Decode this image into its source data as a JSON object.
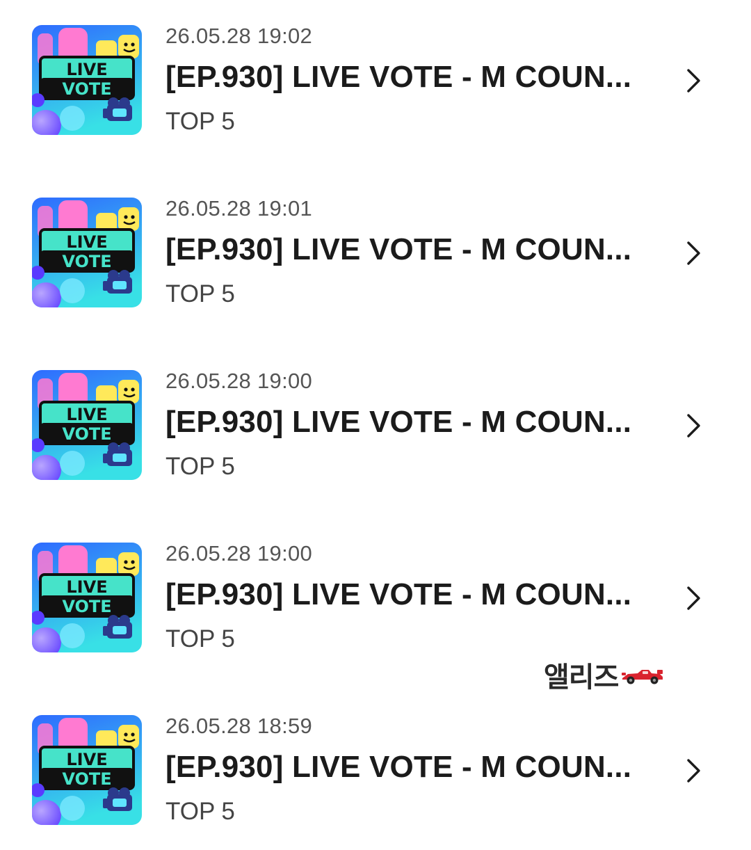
{
  "thumbnail": {
    "line1": "LIVE",
    "line2": "VOTE",
    "icon": "live-vote-thumbnail-icon",
    "colors": {
      "background_top": "#2f6bff",
      "background_bottom": "#38e0e6",
      "banner": "#46e3c9",
      "banner_border": "#101010",
      "pink_shape": "#ff7ad1",
      "yellow_shape": "#ffe95a",
      "purple_sphere": "#6b4dff"
    }
  },
  "items": [
    {
      "date": "26.05.28 19:02",
      "title": "[EP.930] LIVE VOTE - M COUN...",
      "subtitle": "TOP 5"
    },
    {
      "date": "26.05.28 19:01",
      "title": "[EP.930] LIVE VOTE - M COUN...",
      "subtitle": "TOP 5"
    },
    {
      "date": "26.05.28 19:00",
      "title": "[EP.930] LIVE VOTE - M COUN...",
      "subtitle": "TOP 5"
    },
    {
      "date": "26.05.28 19:00",
      "title": "[EP.930] LIVE VOTE - M COUN...",
      "subtitle": "TOP 5"
    },
    {
      "date": "26.05.28 18:59",
      "title": "[EP.930] LIVE VOTE - M COUN...",
      "subtitle": "TOP 5"
    }
  ],
  "chevron_icon": "chevron-right-icon",
  "watermark": {
    "text": "앨리즈",
    "icon": "race-car-icon",
    "icon_color": "#d9232e"
  }
}
